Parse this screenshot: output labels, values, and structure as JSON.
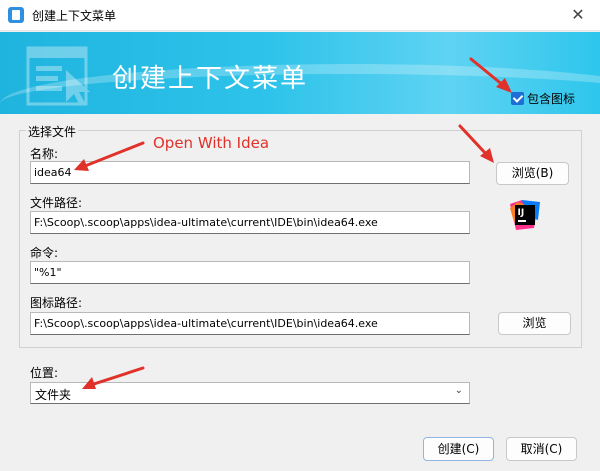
{
  "window": {
    "title": "创建上下文菜单",
    "close_glyph": "✕"
  },
  "banner": {
    "title": "创建上下文菜单"
  },
  "options": {
    "include_icon_label": "包含图标",
    "include_icon_checked": true
  },
  "group": {
    "label": "选择文件"
  },
  "form": {
    "name_label": "名称:",
    "name_value": "idea64",
    "path_label": "文件路径:",
    "path_value": "F:\\Scoop\\.scoop\\apps\\idea-ultimate\\current\\IDE\\bin\\idea64.exe",
    "command_label": "命令:",
    "command_value": "\"%1\"",
    "icon_path_label": "图标路径:",
    "icon_path_value": "F:\\Scoop\\.scoop\\apps\\idea-ultimate\\current\\IDE\\bin\\idea64.exe",
    "browse_exe_label": "浏览(B)",
    "browse_icon_label": "浏览"
  },
  "location": {
    "label": "位置:",
    "selected": "文件夹"
  },
  "footer": {
    "create_label": "创建(C)",
    "cancel_label": "取消(C)"
  },
  "annotations": {
    "note": "Open With Idea",
    "color": "#e0312a"
  },
  "icons": [
    "app-icon",
    "close-icon",
    "banner-icon",
    "checkbox-icon",
    "idea-logo-icon",
    "chevron-down-icon"
  ],
  "colors": {
    "banner": "#2ec3ea",
    "accent": "#1d6fd6",
    "annotation": "#e0312a"
  }
}
